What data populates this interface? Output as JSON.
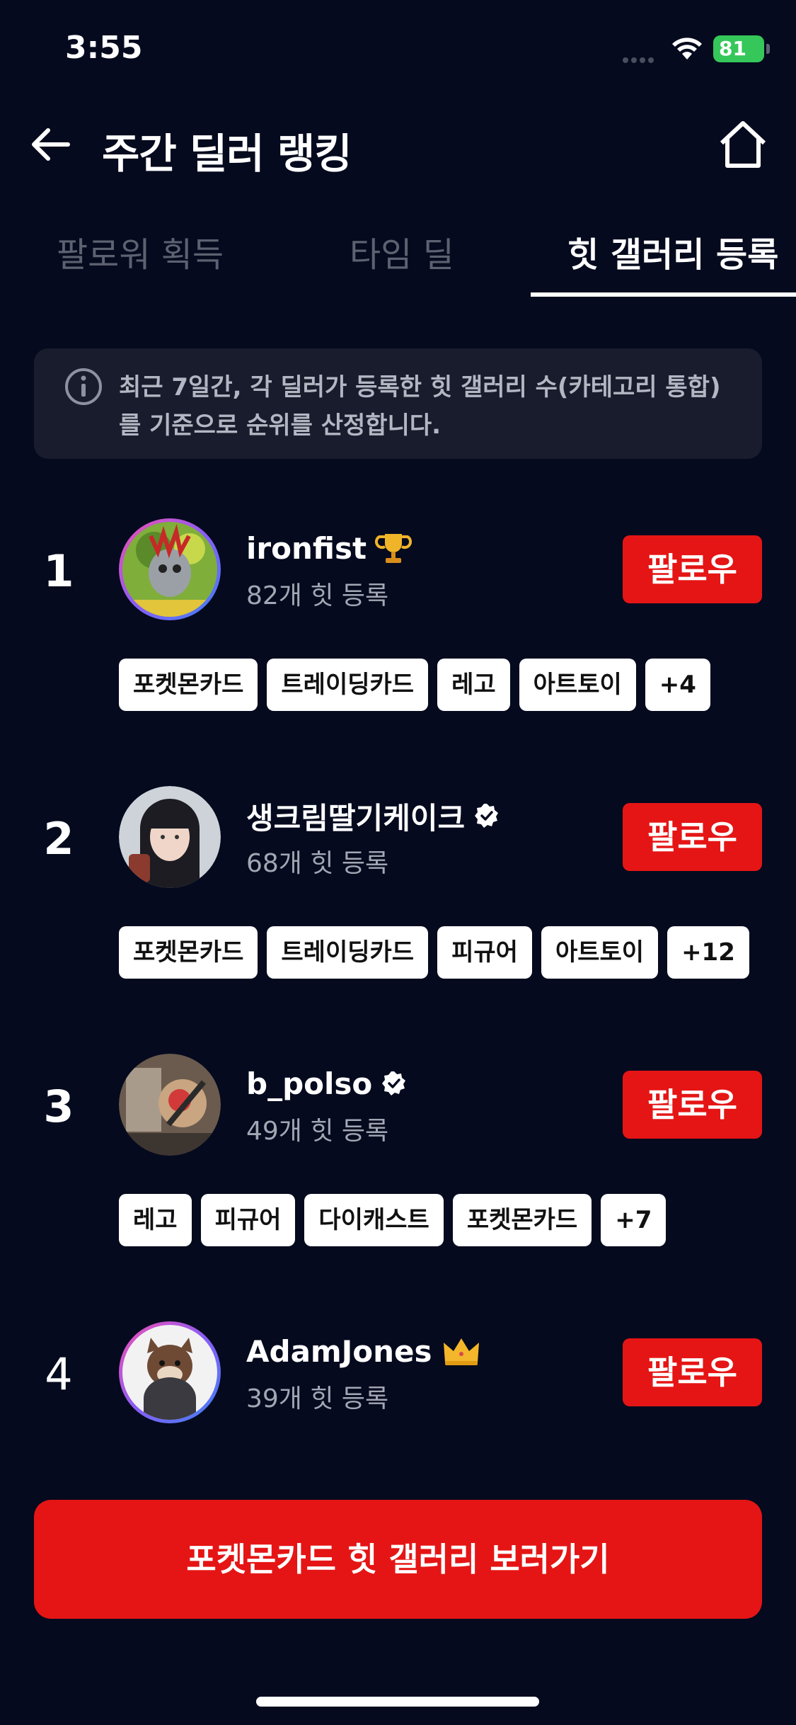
{
  "status_bar": {
    "time": "3:55",
    "battery": "81"
  },
  "header": {
    "title": "주간 딜러 랭킹"
  },
  "tabs": [
    {
      "label": "팔로워 획득",
      "active": false
    },
    {
      "label": "타임 딜",
      "active": false
    },
    {
      "label": "힛 갤러리 등록",
      "active": true
    }
  ],
  "info": {
    "text": "최근 7일간, 각 딜러가 등록한 힛 갤러리 수(카테고리 통합)를 기준으로 순위를 산정합니다."
  },
  "follow_label": "팔로우",
  "rankings": [
    {
      "rank": "1",
      "name": "ironfist",
      "badge": "trophy-icon",
      "hits": "82개 힛 등록",
      "tags": [
        "포켓몬카드",
        "트레이딩카드",
        "레고",
        "아트토이",
        "+4"
      ]
    },
    {
      "rank": "2",
      "name": "생크림딸기케이크",
      "badge": "verified-icon",
      "hits": "68개 힛 등록",
      "tags": [
        "포켓몬카드",
        "트레이딩카드",
        "피규어",
        "아트토이",
        "+12"
      ]
    },
    {
      "rank": "3",
      "name": "b_polso",
      "badge": "verified-icon",
      "hits": "49개 힛 등록",
      "tags": [
        "레고",
        "피규어",
        "다이캐스트",
        "포켓몬카드",
        "+7"
      ]
    },
    {
      "rank": "4",
      "name": "AdamJones",
      "badge": "crown-icon",
      "hits": "39개 힛 등록",
      "tags": []
    }
  ],
  "cta": {
    "label": "포켓몬카드 힛 갤러리 보러가기"
  },
  "colors": {
    "background": "#050a1e",
    "accent": "#e51515",
    "info_box": "#181c2c"
  }
}
